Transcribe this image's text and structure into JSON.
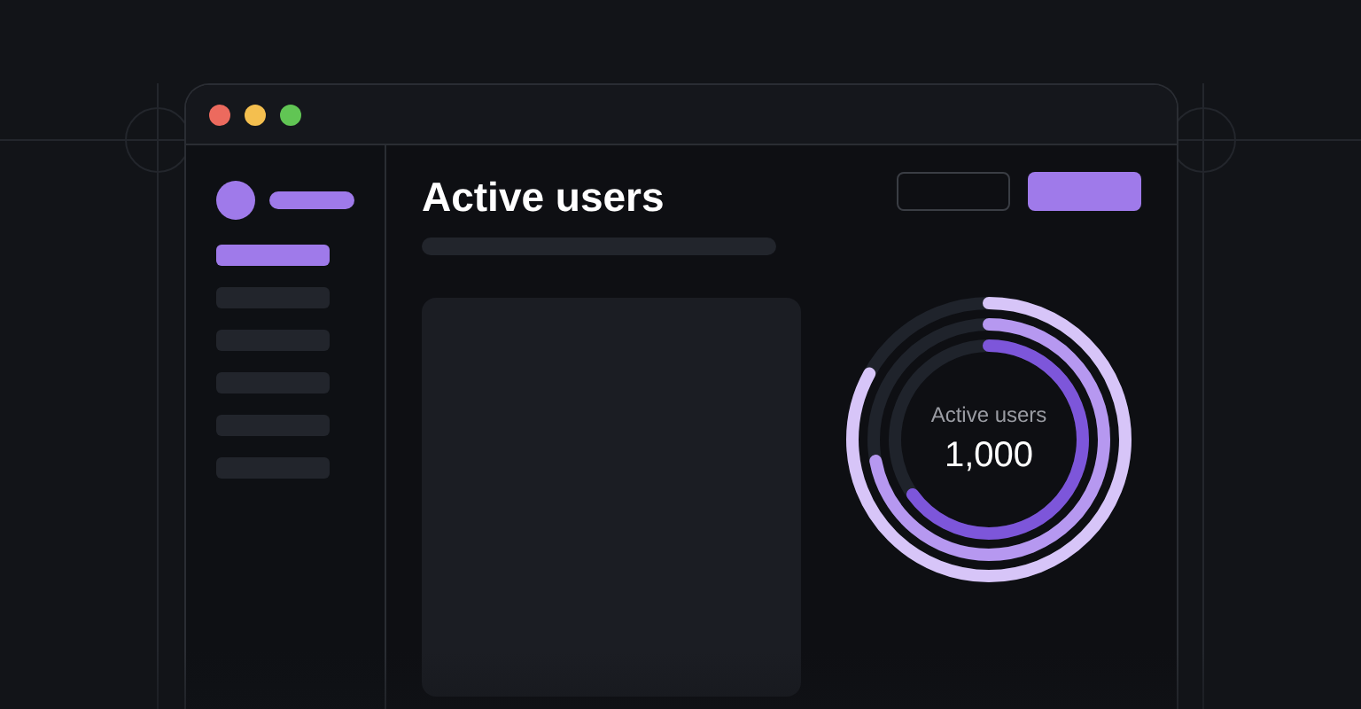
{
  "window": {
    "controls": [
      {
        "color": "#ec6a5e"
      },
      {
        "color": "#f4bf4f"
      },
      {
        "color": "#61c554"
      }
    ]
  },
  "sidebar": {
    "items": [
      {
        "selected": true
      },
      {
        "selected": false
      },
      {
        "selected": false
      },
      {
        "selected": false
      },
      {
        "selected": false
      },
      {
        "selected": false
      }
    ]
  },
  "header": {
    "title": "Active users",
    "buttons": [
      {
        "kind": "outline"
      },
      {
        "kind": "filled"
      }
    ]
  },
  "chart": {
    "label": "Active users",
    "value": "1,000",
    "rings": [
      {
        "level": 0.83,
        "color": "#d7c5f8"
      },
      {
        "level": 0.72,
        "color": "#b698f0"
      },
      {
        "level": 0.65,
        "color": "#7d56da"
      }
    ]
  }
}
